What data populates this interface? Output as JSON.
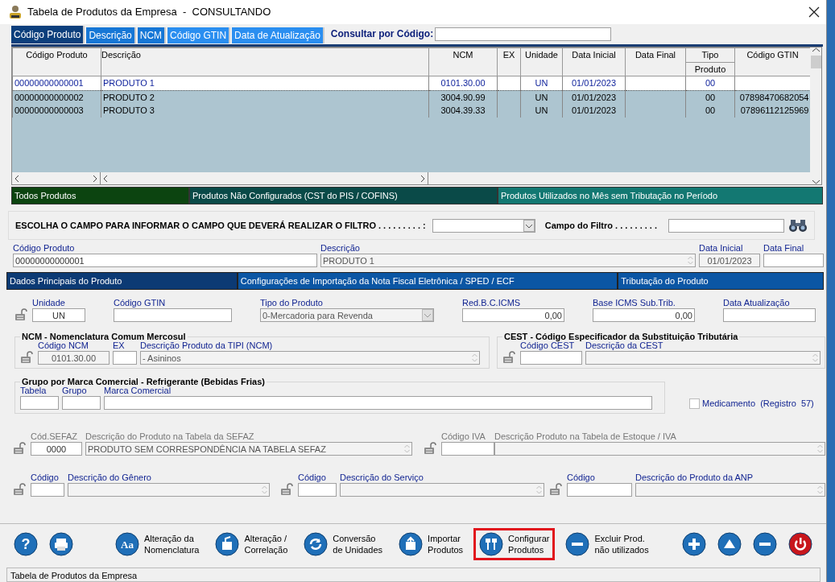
{
  "window": {
    "title": "Tabela de Produtos da Empresa  -  CONSULTANDO"
  },
  "search_tabs": [
    {
      "label": "Código Produto",
      "selected": true
    },
    {
      "label": "Descrição",
      "selected": false
    },
    {
      "label": "NCM",
      "selected": false
    },
    {
      "label": "Código GTIN",
      "selected": false
    },
    {
      "label": "Data de Atualização",
      "selected": false
    }
  ],
  "consult": {
    "label": "Consultar por Código:"
  },
  "table": {
    "columns": [
      {
        "label": "Código Produto"
      },
      {
        "label": "Descrição"
      },
      {
        "label": "NCM"
      },
      {
        "label": "EX"
      },
      {
        "label": "Unidade"
      },
      {
        "label": "Data Inicial"
      },
      {
        "label": "Data Final"
      },
      {
        "label": "Tipo",
        "sublabel": "Produto"
      },
      {
        "label": "Código GTIN"
      }
    ],
    "rows": [
      {
        "selected": true,
        "cells": [
          "00000000000001",
          "PRODUTO 1",
          "0101.30.00",
          "",
          "UN",
          "01/01/2023",
          "",
          "00",
          ""
        ]
      },
      {
        "selected": false,
        "cells": [
          "00000000000002",
          "PRODUTO 2",
          "3004.90.99",
          "",
          "UN",
          "01/01/2023",
          "",
          "00",
          "07898470682054"
        ]
      },
      {
        "selected": false,
        "cells": [
          "00000000000003",
          "PRODUTO 3",
          "3004.39.33",
          "",
          "UN",
          "01/01/2023",
          "",
          "00",
          "07896112125969"
        ]
      }
    ]
  },
  "filter_tabs": [
    {
      "label": "Todos Produtos",
      "selected": true
    },
    {
      "label": "Produtos Não Configurados (CST do PIS / COFINS)",
      "selected": false
    },
    {
      "label": "Produtos Utilizados no Mês sem Tributação no Período",
      "selected": false
    }
  ],
  "filter": {
    "label": "ESCOLHA O CAMPO PARA INFORMAR O CAMPO QUE DEVERÁ REALIZAR O FILTRO . . . . . . . . . :",
    "field_label": "Campo do Filtro . . . . . . . . ."
  },
  "header_fields": [
    {
      "label": "Código Produto",
      "value": "00000000000001",
      "readonly": false,
      "kind": "text"
    },
    {
      "label": "Descrição",
      "value": "PRODUTO 1",
      "readonly": true,
      "kind": "spin"
    },
    {
      "label": "Data Inicial",
      "value": "01/01/2023",
      "readonly": true,
      "kind": "centered"
    },
    {
      "label": "Data Final",
      "readonly": false,
      "kind": "text"
    }
  ],
  "detail_tabs": [
    {
      "label": "Dados Principais do Produto",
      "selected": true
    },
    {
      "label": "Configurações de Importação da Nota Fiscal Eletrônica / SPED / ECF",
      "selected": false
    },
    {
      "label": "Tributação do Produto",
      "selected": false
    }
  ],
  "main_row": {
    "disabled": false,
    "fields": [
      {
        "label": "Unidade",
        "value": "UN",
        "readonly": false,
        "kind": "centered"
      },
      {
        "label": "Código GTIN",
        "readonly": false,
        "kind": "text"
      },
      {
        "label": "Tipo do Produto",
        "value": "0-Mercadoria para Revenda",
        "readonly": true,
        "kind": "combo"
      },
      {
        "label": "Red.B.C.ICMS",
        "value": "0,00",
        "readonly": false,
        "kind": "number"
      },
      {
        "label": "Base ICMS Sub.Trib.",
        "value": "0,00",
        "readonly": false,
        "kind": "number"
      },
      {
        "label": "Data Atualização",
        "readonly": false,
        "kind": "text"
      }
    ]
  },
  "ncm_group": {
    "title": "NCM - Nomenclatura Comum Mercosul",
    "disabled": false,
    "fields": [
      {
        "label": "Código NCM",
        "value": "0101.30.00",
        "readonly": true,
        "kind": "centered"
      },
      {
        "label": "EX",
        "readonly": false,
        "kind": "text"
      },
      {
        "label": "Descrição Produto da TIPI (NCM)",
        "value": "- Asininos",
        "readonly": true,
        "kind": "spin"
      }
    ]
  },
  "cest_group": {
    "title": "CEST - Código Especificador da Substituição Tributária",
    "disabled": false,
    "fields": [
      {
        "label": "Código CEST",
        "readonly": false,
        "kind": "text"
      },
      {
        "label": "Descrição da CEST",
        "readonly": true,
        "kind": "spin"
      }
    ]
  },
  "brand_group": {
    "title": "Grupo por Marca Comercial - Refrigerante (Bebidas Frias)",
    "disabled": false,
    "fields": [
      {
        "label": "Tabela",
        "readonly": false,
        "kind": "text"
      },
      {
        "label": "Grupo",
        "readonly": false,
        "kind": "text"
      },
      {
        "label": "Marca Comercial",
        "readonly": false,
        "kind": "text"
      }
    ]
  },
  "medicamento": {
    "label": "Medicamento  (Registro  57)",
    "checked": false
  },
  "sefaz_row": {
    "disabled": true,
    "fields": [
      {
        "label": "Cód.SEFAZ",
        "value": "0000",
        "readonly": false,
        "kind": "centered"
      },
      {
        "label": "Descrição do Produto na Tabela da SEFAZ",
        "value": "PRODUTO SEM CORRESPONDÊNCIA NA TABELA SEFAZ",
        "readonly": true,
        "kind": "spin"
      }
    ]
  },
  "iva_row": {
    "disabled": true,
    "fields": [
      {
        "label": "Código IVA",
        "readonly": false,
        "kind": "text"
      },
      {
        "label": "Descrição Produto na Tabela de Estoque / IVA",
        "readonly": true,
        "kind": "spin"
      }
    ]
  },
  "genero_row": {
    "disabled": false,
    "fields": [
      {
        "label": "Código",
        "readonly": false,
        "kind": "text"
      },
      {
        "label": "Descrição do Gênero",
        "readonly": true,
        "kind": "spin"
      }
    ]
  },
  "servico_row": {
    "disabled": false,
    "fields": [
      {
        "label": "Código",
        "readonly": false,
        "kind": "text"
      },
      {
        "label": "Descrição do Serviço",
        "readonly": true,
        "kind": "spin"
      }
    ]
  },
  "anp_row": {
    "disabled": false,
    "fields": [
      {
        "label": "Código",
        "readonly": false,
        "kind": "text"
      },
      {
        "label": "Descrição do Produto da ANP",
        "readonly": true,
        "kind": "spin"
      }
    ]
  },
  "toolbar": [
    {
      "kind": "help",
      "glyph": "?",
      "highlighted": false
    },
    {
      "kind": "print",
      "highlighted": false
    },
    {
      "kind": "aa",
      "glyph": "Aa",
      "lines": [
        "Alteração da",
        "Nomenclatura"
      ],
      "highlighted": false
    },
    {
      "kind": "relation",
      "lines": [
        "Alteração /",
        "Correlação"
      ],
      "highlighted": false
    },
    {
      "kind": "convert",
      "lines": [
        "Conversão",
        "de Unidades"
      ],
      "highlighted": false
    },
    {
      "kind": "import",
      "lines": [
        "Importar",
        "Produtos"
      ],
      "highlighted": false
    },
    {
      "kind": "config",
      "lines": [
        "Configurar",
        "Produtos"
      ],
      "highlighted": true
    },
    {
      "kind": "remove",
      "lines": [
        "Excluir Prod.",
        "não utilizados"
      ],
      "highlighted": false
    },
    {
      "kind": "add",
      "highlighted": false
    },
    {
      "kind": "up",
      "highlighted": false
    },
    {
      "kind": "minus",
      "highlighted": false
    },
    {
      "kind": "power",
      "highlighted": false
    }
  ],
  "status_bar": {
    "text": "Tabela de Produtos da Empresa"
  }
}
